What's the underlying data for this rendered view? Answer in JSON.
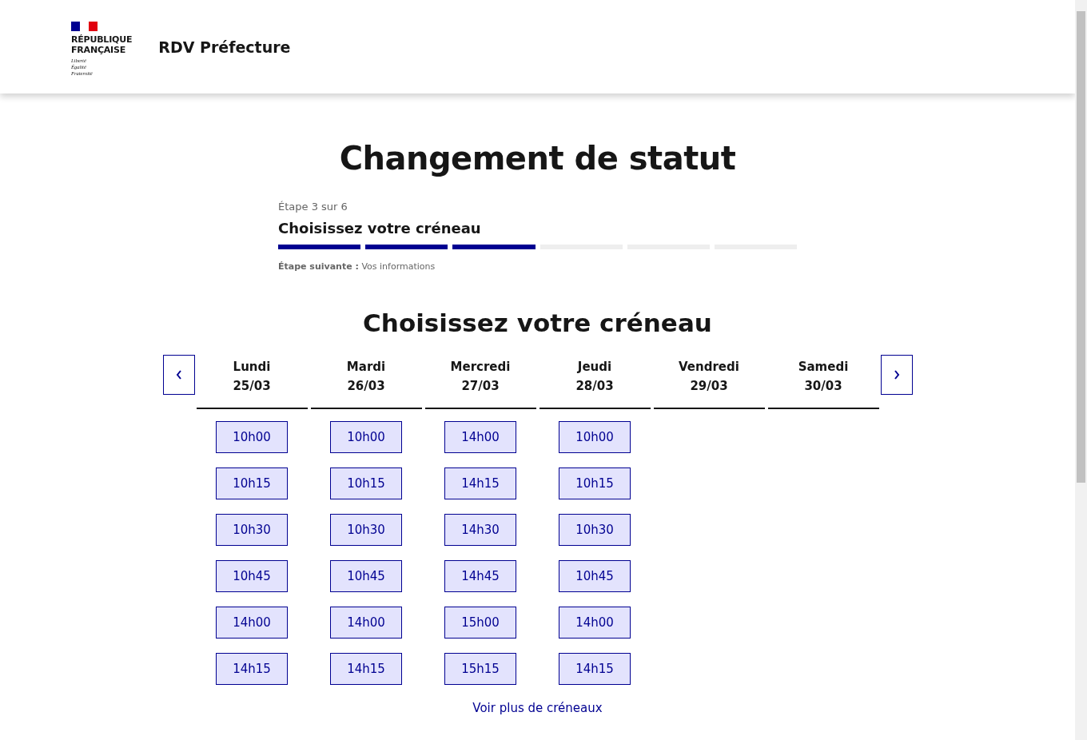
{
  "header": {
    "logo_name": "RÉPUBLIQUE\nFRANÇAISE",
    "motto": [
      "Liberté",
      "Égalité",
      "Fraternité"
    ],
    "service_title": "RDV Préfecture"
  },
  "page_title": "Changement de statut",
  "stepper": {
    "step_label": "Étape 3 sur 6",
    "step_title": "Choisissez votre créneau",
    "segments": [
      {
        "done": true
      },
      {
        "done": true
      },
      {
        "done": true
      },
      {
        "done": false
      },
      {
        "done": false
      },
      {
        "done": false
      }
    ],
    "next_label": "Étape suivante :",
    "next_value": "Vos informations"
  },
  "section_title": "Choisissez votre créneau",
  "days": [
    {
      "day": "Lundi",
      "date": "25/03",
      "slots": [
        "10h00",
        "10h15",
        "10h30",
        "10h45",
        "14h00",
        "14h15"
      ]
    },
    {
      "day": "Mardi",
      "date": "26/03",
      "slots": [
        "10h00",
        "10h15",
        "10h30",
        "10h45",
        "14h00",
        "14h15"
      ]
    },
    {
      "day": "Mercredi",
      "date": "27/03",
      "slots": [
        "14h00",
        "14h15",
        "14h30",
        "14h45",
        "15h00",
        "15h15"
      ]
    },
    {
      "day": "Jeudi",
      "date": "28/03",
      "slots": [
        "10h00",
        "10h15",
        "10h30",
        "10h45",
        "14h00",
        "14h15"
      ]
    },
    {
      "day": "Vendredi",
      "date": "29/03"
    },
    {
      "day": "Samedi",
      "date": "30/03"
    }
  ],
  "more_link": "Voir plus de créneaux"
}
